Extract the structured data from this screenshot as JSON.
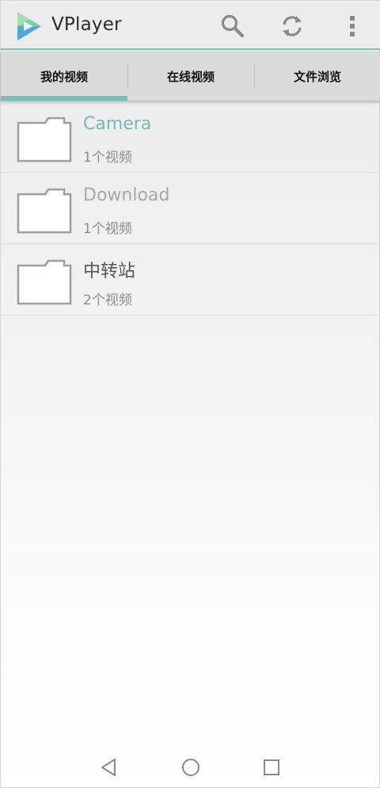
{
  "app": {
    "title": "VPlayer",
    "colors": {
      "accent": "#79c3bf",
      "logo_top": "#7ccbb4",
      "logo_bottom": "#4fa8d8"
    },
    "icons": {
      "logo": "vplayer-logo",
      "search": "search-icon",
      "refresh": "refresh-icon",
      "more": "more-vert-icon"
    }
  },
  "tabs": [
    {
      "label": "我的视频",
      "selected": true
    },
    {
      "label": "在线视频",
      "selected": false
    },
    {
      "label": "文件浏览",
      "selected": false
    }
  ],
  "folders": [
    {
      "name": "Camera",
      "count": "1个视频",
      "style": "accent"
    },
    {
      "name": "Download",
      "count": "1个视频",
      "style": "muted"
    },
    {
      "name": "中转站",
      "count": "2个视频",
      "style": "normal"
    }
  ],
  "navbar": {
    "icons": [
      "back-icon",
      "home-icon",
      "recents-icon"
    ]
  }
}
